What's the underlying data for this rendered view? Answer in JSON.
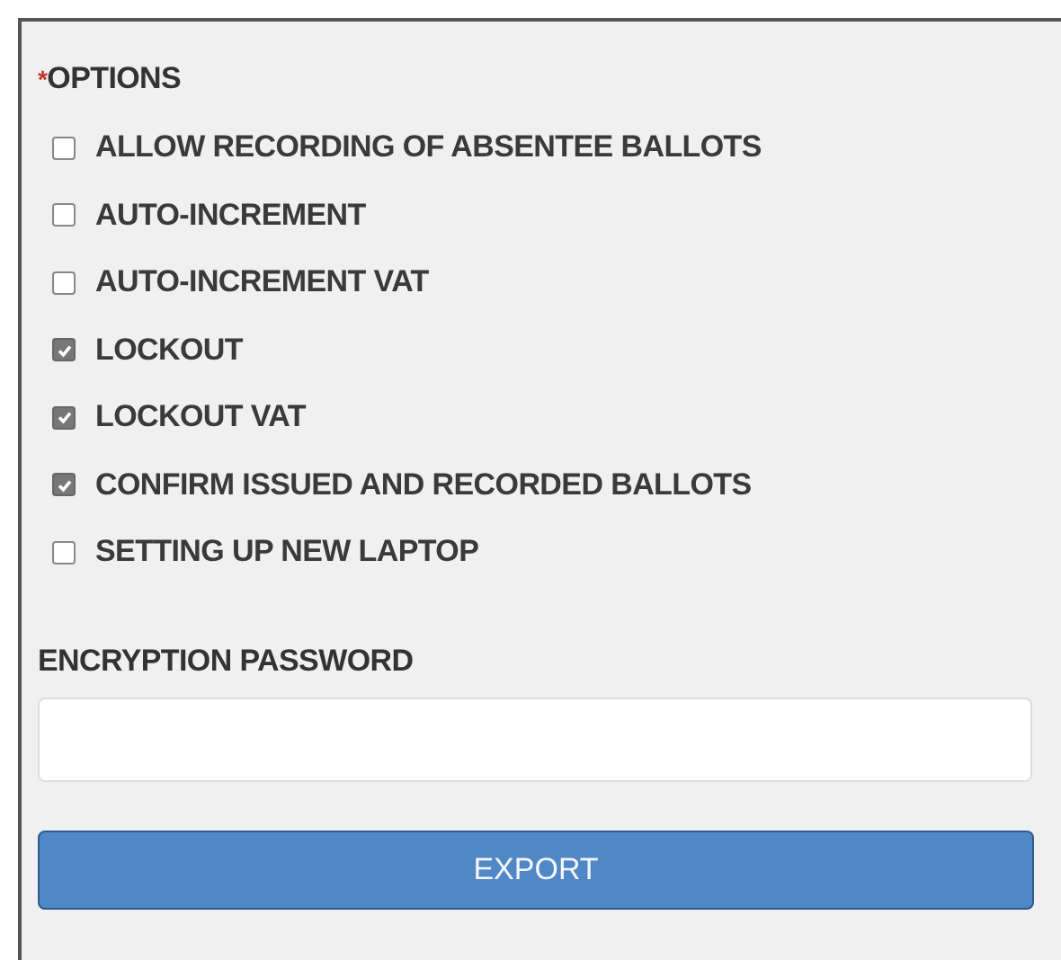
{
  "options": {
    "required_mark": "*",
    "label": "OPTIONS",
    "items": [
      {
        "label": "ALLOW RECORDING OF ABSENTEE BALLOTS",
        "checked": false
      },
      {
        "label": "AUTO-INCREMENT",
        "checked": false
      },
      {
        "label": "AUTO-INCREMENT VAT",
        "checked": false
      },
      {
        "label": "LOCKOUT",
        "checked": true
      },
      {
        "label": "LOCKOUT VAT",
        "checked": true
      },
      {
        "label": "CONFIRM ISSUED AND RECORDED BALLOTS",
        "checked": true
      },
      {
        "label": "SETTING UP NEW LAPTOP",
        "checked": false
      }
    ]
  },
  "password": {
    "label": "ENCRYPTION PASSWORD"
  },
  "buttons": [
    {
      "label": "EXPORT"
    }
  ]
}
